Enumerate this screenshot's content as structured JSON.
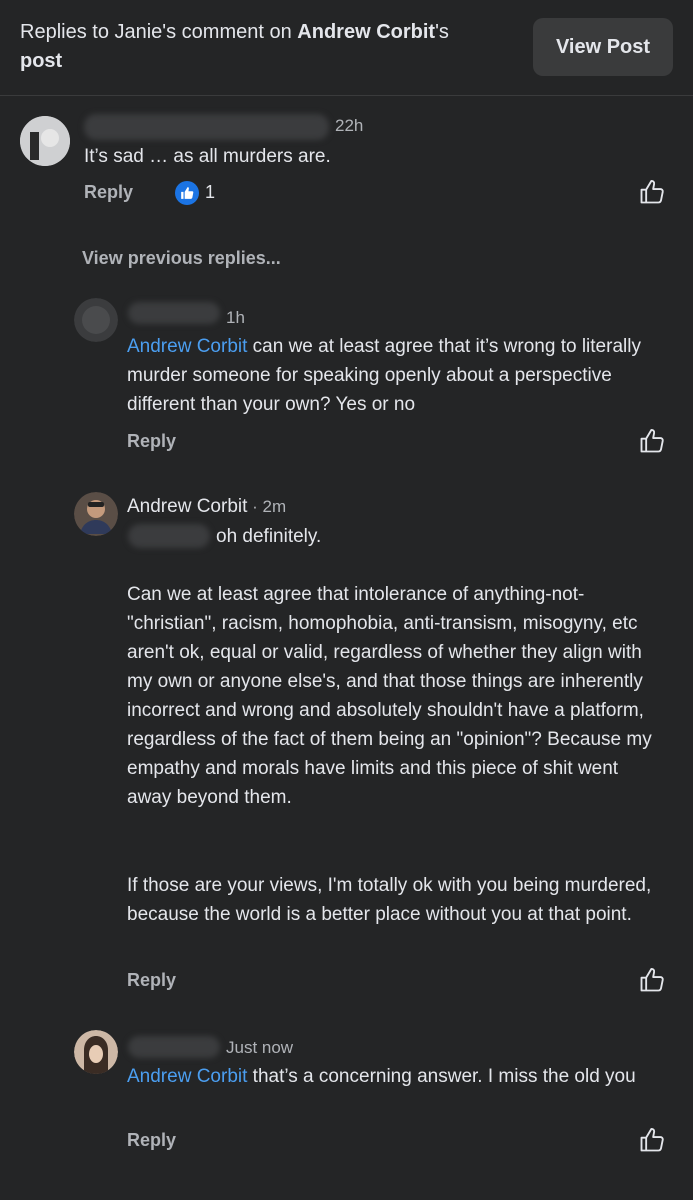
{
  "header": {
    "title_prefix": "Replies to Janie's comment on ",
    "title_name": "Andrew Corbit",
    "title_suffix": "'s",
    "title_line2": "post",
    "view_post_label": "View Post"
  },
  "comments": [
    {
      "time": "22h",
      "text": "It’s sad … as all murders are.",
      "reply_label": "Reply",
      "like_count": "1"
    },
    {
      "time": "1h",
      "mention": "Andrew Corbit",
      "text": " can we at least agree that it’s wrong to literally murder someone for speaking openly about a perspective different than your own? Yes or no",
      "reply_label": "Reply"
    },
    {
      "author": "Andrew Corbit",
      "time": " · 2m",
      "line1": "oh definitely.",
      "para1": "Can we at least agree that intolerance of anything-not-\"christian\", racism, homophobia, anti-transism, misogyny,  etc aren't ok, equal or valid, regardless of whether they align with my own or anyone else's, and that those things are inherently incorrect and wrong and absolutely shouldn't have a platform, regardless of the fact of them being an \"opinion\"? Because my empathy and morals have limits and this piece of shit went away beyond them.",
      "para2": "If those are your views, I'm totally ok with you being murdered, because the world is a better place without you at that point.",
      "reply_label": "Reply"
    },
    {
      "time": "Just now",
      "mention": "Andrew Corbit",
      "text": " that’s a concerning answer. I miss the old you",
      "reply_label": "Reply"
    }
  ],
  "view_previous_label": "View previous replies...",
  "icons": {
    "like": "thumbs-up-outline-icon",
    "like_badge": "thumbs-up-filled-icon"
  },
  "colors": {
    "background": "#242526",
    "mention": "#4b9ef0",
    "like_badge": "#1b74e4"
  }
}
